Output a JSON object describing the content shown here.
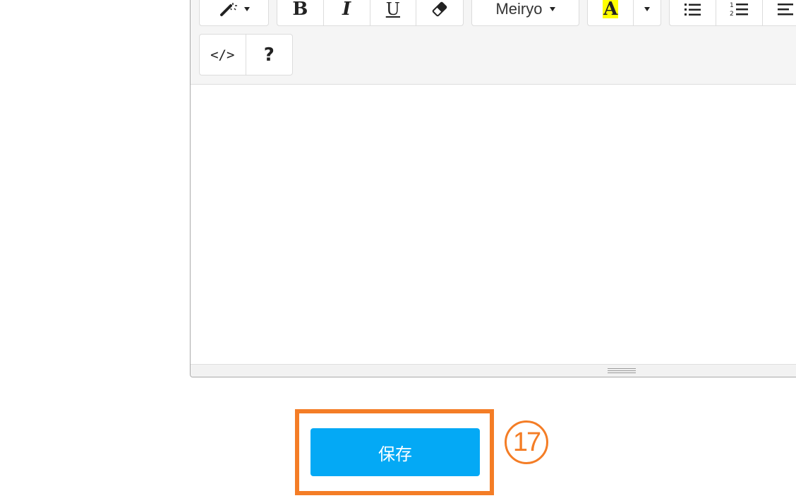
{
  "toolbar": {
    "style_button": {
      "icon": "magic-wand-icon"
    },
    "bold": {
      "label": "B"
    },
    "italic": {
      "label": "I"
    },
    "underline": {
      "label": "U"
    },
    "clear_format": {
      "icon": "eraser-icon"
    },
    "font_name": {
      "label": "Meiryo"
    },
    "highlight_color": {
      "label": "A",
      "color": "#ffff00"
    },
    "unordered_list": {
      "icon": "unordered-list-icon"
    },
    "ordered_list": {
      "icon": "ordered-list-icon"
    },
    "align": {
      "icon": "align-left-icon"
    },
    "code_view": {
      "label": "</>"
    },
    "help": {
      "label": "?"
    }
  },
  "editor": {
    "content": ""
  },
  "save_button": {
    "label": "保存"
  },
  "annotation": {
    "step_number": "17",
    "color": "#f47d26"
  },
  "colors": {
    "save_button_bg": "#04a9f5",
    "annotation_orange": "#f47d26",
    "toolbar_bg": "#f5f5f5"
  }
}
